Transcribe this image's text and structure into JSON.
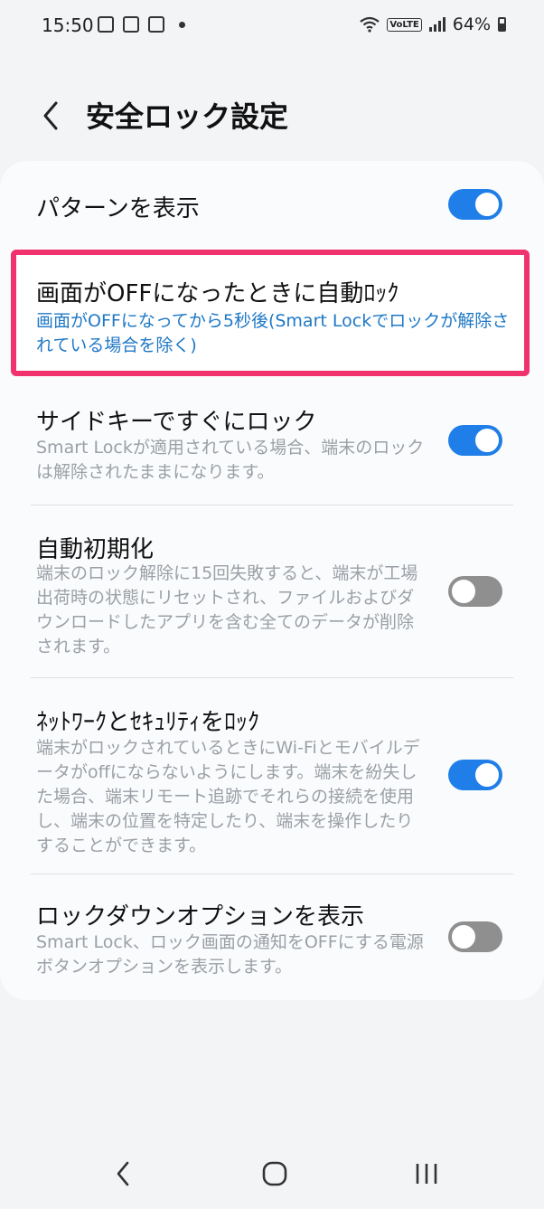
{
  "status_bar": {
    "time": "15:50",
    "battery": "64%",
    "network_label": "VoLTE"
  },
  "header": {
    "title": "安全ロック設定"
  },
  "settings": [
    {
      "title": "パターンを表示",
      "description": "",
      "toggle": true
    },
    {
      "title": "画面がOFFになったときに自動ﾛｯｸ",
      "description": "画面がOFFになってから5秒後(Smart Lockでロックが解除されている場合を除く)"
    },
    {
      "title": "サイドキーですぐにロック",
      "description": "Smart Lockが適用されている場合、端末のロックは解除されたままになります。",
      "toggle": true
    },
    {
      "title": "自動初期化",
      "description": "端末のロック解除に15回失敗すると、端末が工場出荷時の状態にリセットされ、ファイルおよびダウンロードしたアプリを含む全てのデータが削除されます。",
      "toggle": false
    },
    {
      "title": "ﾈｯﾄﾜｰｸとｾｷｭﾘﾃｨをﾛｯｸ",
      "description": "端末がロックされているときにWi-Fiとモバイルデータがoffにならないようにします。端末を紛失した場合、端末リモート追跡でそれらの接続を使用し、端末の位置を特定したり、端末を操作したりすることができます。",
      "toggle": true
    },
    {
      "title": "ロックダウンオプションを表示",
      "description": "Smart Lock、ロック画面の通知をOFFにする電源ボタンオプションを表示します。",
      "toggle": false
    }
  ],
  "colors": {
    "accent": "#1f7ee8",
    "highlight_border": "#f0336e",
    "link_text": "#1f78c6"
  }
}
